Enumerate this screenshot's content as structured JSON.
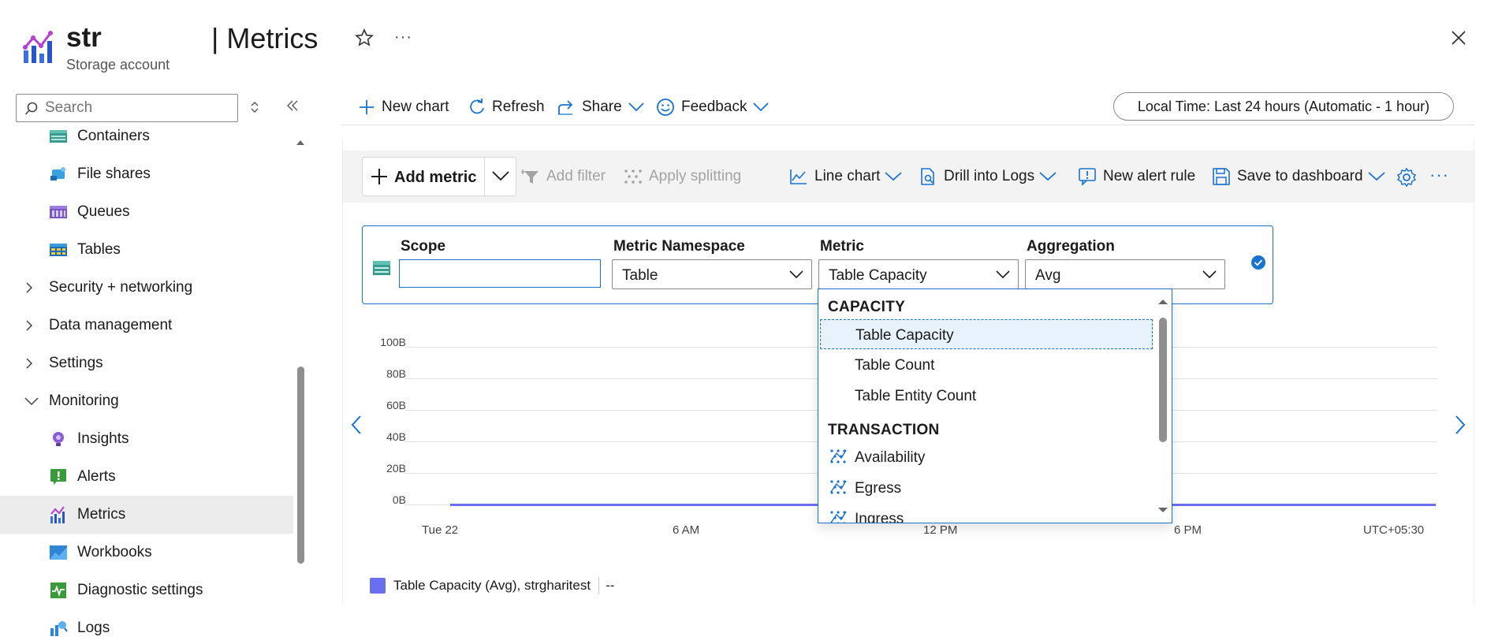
{
  "header": {
    "resource_name": "str",
    "separator_title": "| Metrics",
    "resource_type": "Storage account"
  },
  "sidebar": {
    "search_placeholder": "Search",
    "items": [
      {
        "label": "Containers",
        "icon": "containers-icon"
      },
      {
        "label": "File shares",
        "icon": "file-shares-icon"
      },
      {
        "label": "Queues",
        "icon": "queues-icon"
      },
      {
        "label": "Tables",
        "icon": "tables-icon"
      }
    ],
    "groups": [
      {
        "label": "Security + networking",
        "expanded": false
      },
      {
        "label": "Data management",
        "expanded": false
      },
      {
        "label": "Settings",
        "expanded": false
      },
      {
        "label": "Monitoring",
        "expanded": true
      }
    ],
    "monitoring_items": [
      {
        "label": "Insights",
        "icon": "insights-icon"
      },
      {
        "label": "Alerts",
        "icon": "alerts-icon"
      },
      {
        "label": "Metrics",
        "icon": "metrics-icon",
        "active": true
      },
      {
        "label": "Workbooks",
        "icon": "workbooks-icon"
      },
      {
        "label": "Diagnostic settings",
        "icon": "diagnostic-settings-icon"
      },
      {
        "label": "Logs",
        "icon": "logs-icon"
      }
    ]
  },
  "toolbar": {
    "new_chart": "New chart",
    "refresh": "Refresh",
    "share": "Share",
    "feedback": "Feedback",
    "time_range": "Local Time: Last 24 hours (Automatic - 1 hour)"
  },
  "chart_toolbar": {
    "add_metric": "Add metric",
    "add_filter": "Add filter",
    "apply_splitting": "Apply splitting",
    "line_chart": "Line chart",
    "drill_into_logs": "Drill into Logs",
    "new_alert_rule": "New alert rule",
    "save_to_dashboard": "Save to dashboard"
  },
  "metric_row": {
    "scope_label": "Scope",
    "scope_value": "",
    "namespace_label": "Metric Namespace",
    "namespace_value": "Table",
    "metric_label": "Metric",
    "metric_value": "Table Capacity",
    "aggregation_label": "Aggregation",
    "aggregation_value": "Avg"
  },
  "metric_dropdown": {
    "groups": [
      {
        "label": "CAPACITY",
        "items": [
          "Table Capacity",
          "Table Count",
          "Table Entity Count"
        ]
      },
      {
        "label": "TRANSACTION",
        "items": [
          "Availability",
          "Egress",
          "Ingress"
        ]
      }
    ],
    "selected": "Table Capacity"
  },
  "chart_data": {
    "type": "line",
    "x_tick_labels": [
      "Tue 22",
      "6 AM",
      "12 PM",
      "6 PM"
    ],
    "timezone": "UTC+05:30",
    "y_tick_labels": [
      "100B",
      "80B",
      "60B",
      "40B",
      "20B",
      "0B"
    ],
    "ylim": [
      0,
      100
    ],
    "grid": true,
    "series": [
      {
        "name": "Table Capacity (Avg), strgharitest",
        "values": [
          0,
          0,
          0,
          0
        ],
        "color": "#6a6ff0"
      }
    ],
    "legend_value": "--",
    "legend_position": "bottom-left"
  },
  "colors": {
    "accent": "#1a73d1",
    "series": "#6a6ff0",
    "active_nav": "#ececec"
  }
}
